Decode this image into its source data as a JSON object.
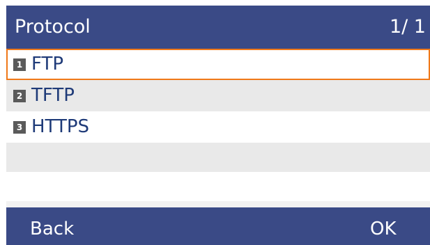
{
  "header": {
    "title": "Protocol",
    "page": "1/ 1"
  },
  "menu": {
    "items": [
      {
        "number": "1",
        "label": "FTP",
        "selected": true
      },
      {
        "number": "2",
        "label": "TFTP",
        "selected": false
      },
      {
        "number": "3",
        "label": "HTTPS",
        "selected": false
      }
    ]
  },
  "softkeys": {
    "left": "Back",
    "right": "OK"
  },
  "colors": {
    "header_bg": "#3a4a86",
    "selection_border": "#f07818",
    "item_text": "#1e3a78",
    "number_badge": "#5a5a5a"
  }
}
